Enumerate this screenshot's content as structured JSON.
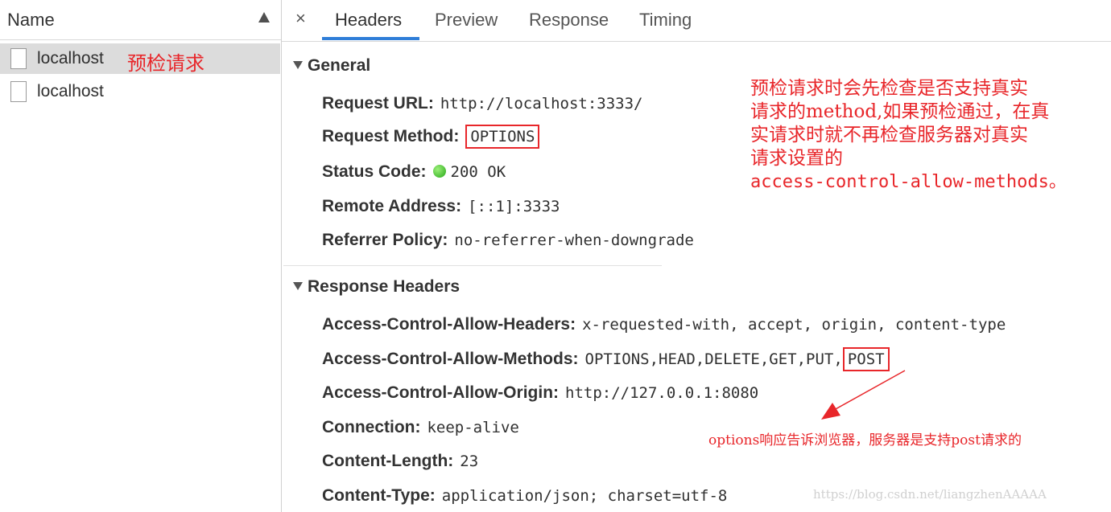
{
  "left": {
    "column_name": "Name",
    "requests": [
      {
        "name": "localhost",
        "note": "预检请求"
      },
      {
        "name": "localhost",
        "note": ""
      }
    ]
  },
  "tabs": {
    "close": "×",
    "items": [
      "Headers",
      "Preview",
      "Response",
      "Timing"
    ],
    "active": "Headers"
  },
  "general": {
    "title": "General",
    "rows": [
      {
        "key": "Request URL:",
        "value": "http://localhost:3333/"
      },
      {
        "key": "Request Method:",
        "value": "OPTIONS"
      },
      {
        "key": "Status Code:",
        "value": "200 OK"
      },
      {
        "key": "Remote Address:",
        "value": "[::1]:3333"
      },
      {
        "key": "Referrer Policy:",
        "value": "no-referrer-when-downgrade"
      }
    ],
    "status_color": "#27a818"
  },
  "response_headers": {
    "title": "Response Headers",
    "rows": [
      {
        "key": "Access-Control-Allow-Headers:",
        "value": "x-requested-with, accept, origin, content-type"
      },
      {
        "key": "Access-Control-Allow-Methods:",
        "value_pre": "OPTIONS,HEAD,DELETE,GET,PUT,",
        "value_boxed": "POST"
      },
      {
        "key": "Access-Control-Allow-Origin:",
        "value": "http://127.0.0.1:8080"
      },
      {
        "key": "Connection:",
        "value": "keep-alive"
      },
      {
        "key": "Content-Length:",
        "value": "23"
      },
      {
        "key": "Content-Type:",
        "value": "application/json; charset=utf-8"
      }
    ]
  },
  "annotations": {
    "note1_line1": "预检请求时会先检查是否支持真实",
    "note1_line2": "请求的method,如果预检通过，在真",
    "note1_line3": "实请求时就不再检查服务器对真实",
    "note1_line4": "请求设置的",
    "note1_code": "access-control-allow-methods。",
    "note2": "options响应告诉浏览器，服务器是支持post请求的",
    "accent_color": "#e8262a"
  },
  "watermark": "https://blog.csdn.net/liangzhenAAAAA"
}
